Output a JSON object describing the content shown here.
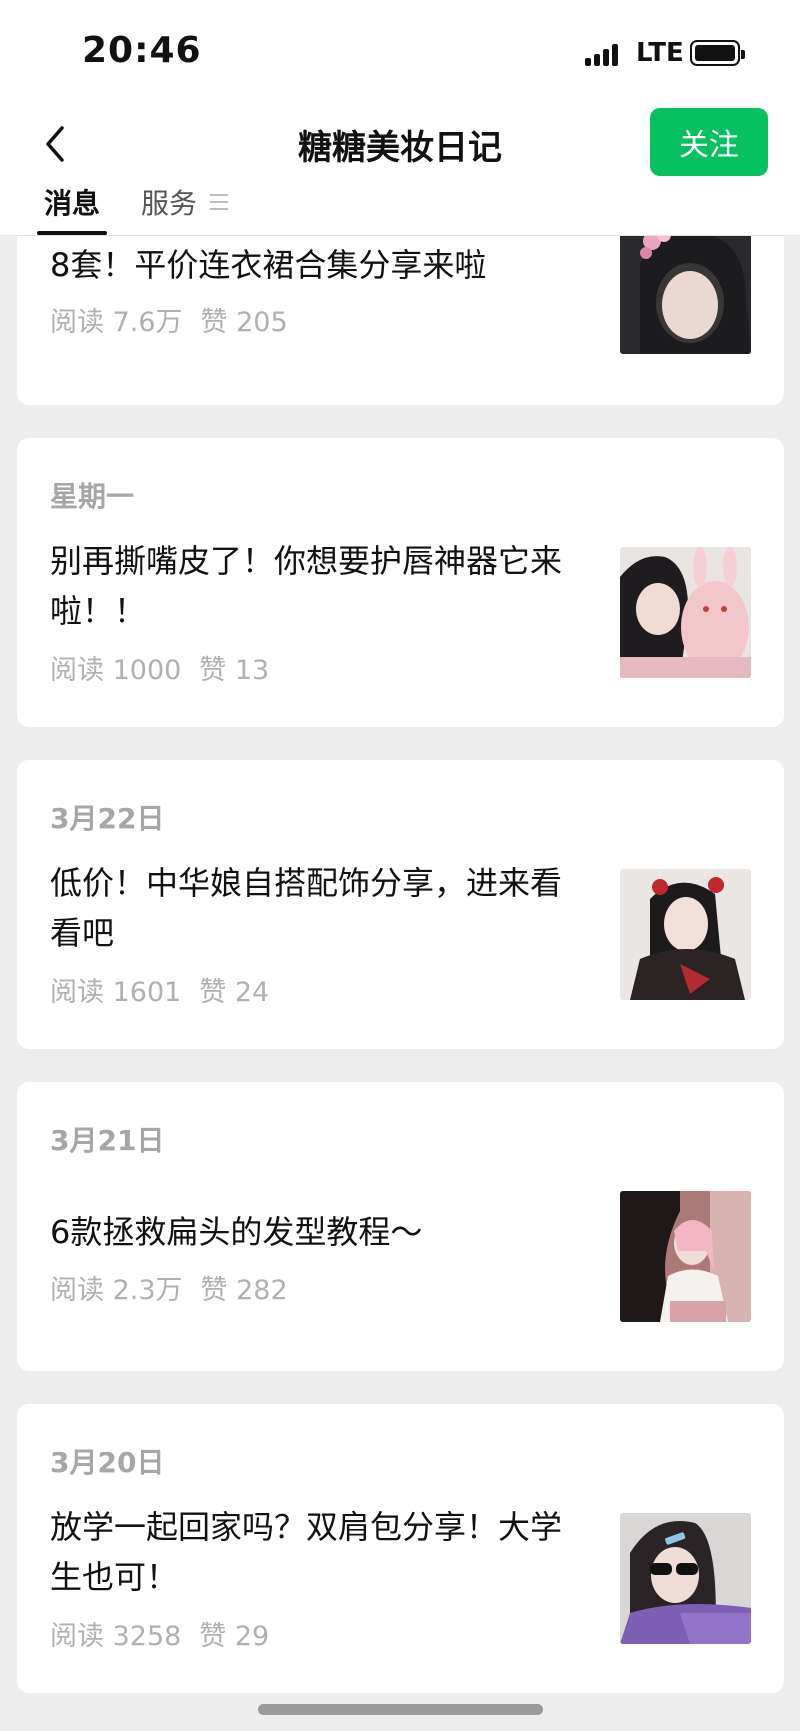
{
  "status_bar": {
    "time": "20:46",
    "network": "LTE"
  },
  "header": {
    "title": "糖糖美妆日记",
    "follow_label": "关注",
    "back_icon": "chevron-left-icon",
    "tabs": [
      {
        "label": "消息",
        "active": true
      },
      {
        "label": "服务",
        "active": false
      }
    ]
  },
  "articles": [
    {
      "date": "",
      "title": "8套！平价连衣裙合集分享来啦",
      "reads": "阅读 7.6万",
      "likes": "赞 205"
    },
    {
      "date": "星期一",
      "title": "别再撕嘴皮了！你想要护唇神器它来啦！！",
      "reads": "阅读 1000",
      "likes": "赞 13"
    },
    {
      "date": "3月22日",
      "title": "低价！中华娘自搭配饰分享，进来看看吧",
      "reads": "阅读 1601",
      "likes": "赞 24"
    },
    {
      "date": "3月21日",
      "title": "6款拯救扁头的发型教程～",
      "reads": "阅读 2.3万",
      "likes": "赞 282"
    },
    {
      "date": "3月20日",
      "title": "放学一起回家吗？双肩包分享！大学生也可！",
      "reads": "阅读 3258",
      "likes": "赞 29"
    }
  ],
  "colors": {
    "accent": "#07c160",
    "background": "#ededed",
    "meta_text": "#b0b0b0"
  }
}
